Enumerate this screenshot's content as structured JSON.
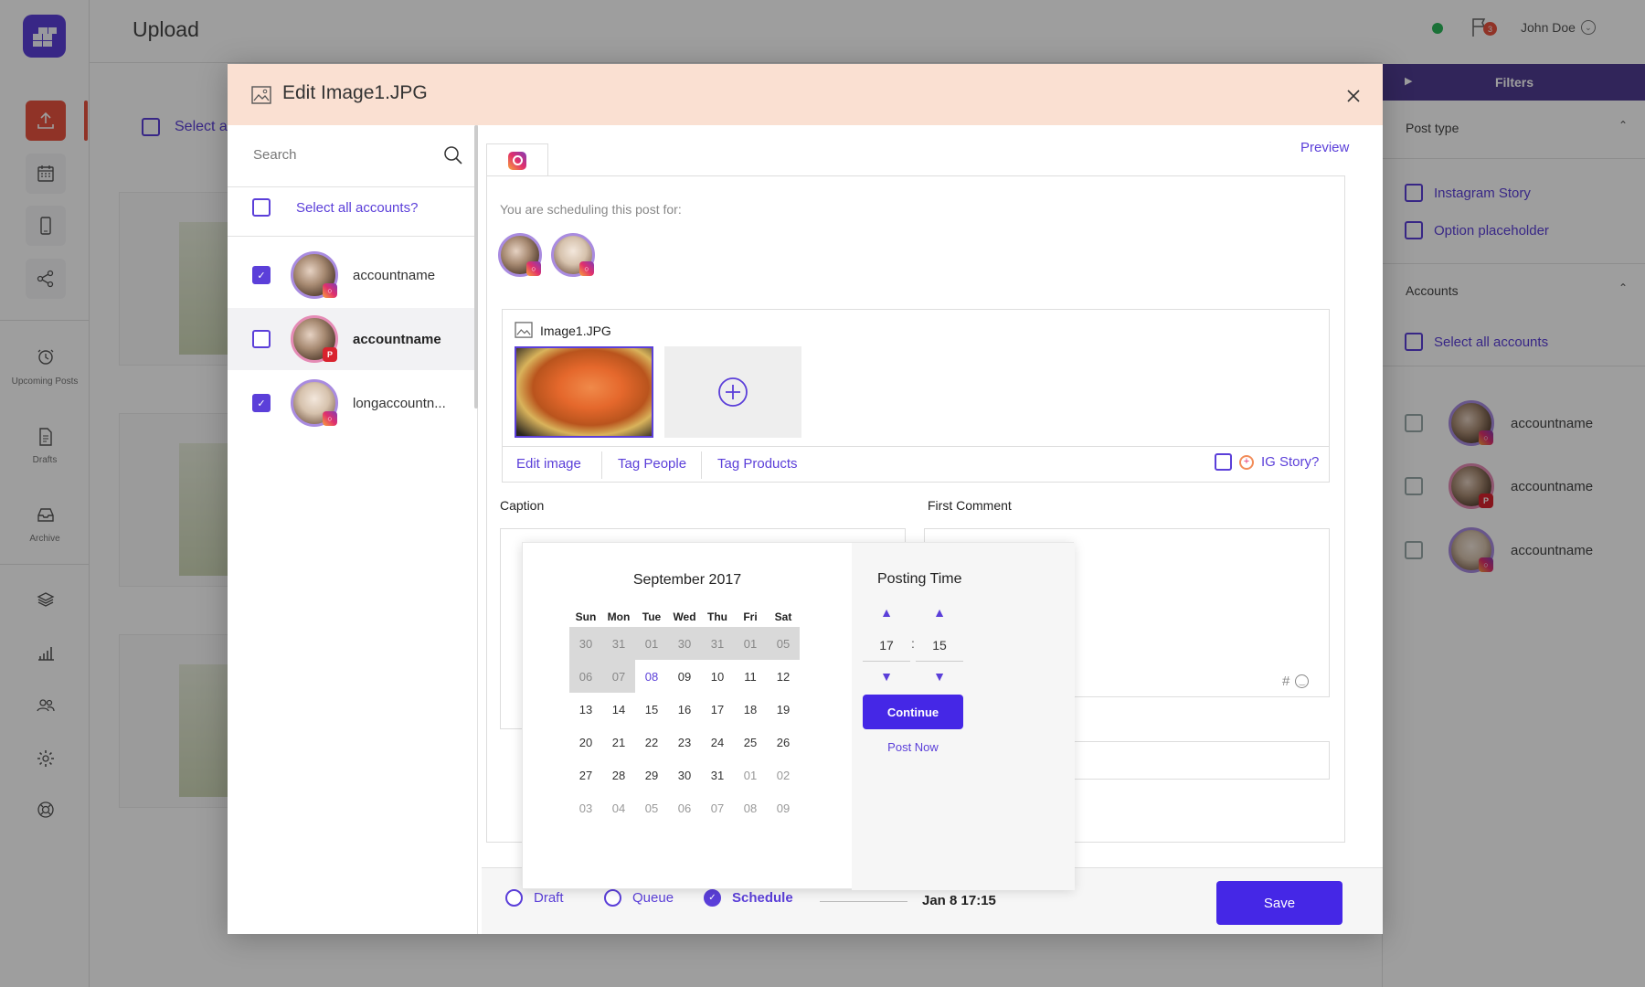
{
  "header": {
    "page_title": "Upload",
    "notifications_count": "3",
    "user_name": "John Doe"
  },
  "nav": {
    "upcoming_label": "Upcoming Posts",
    "drafts_label": "Drafts",
    "archive_label": "Archive"
  },
  "background": {
    "select_all_label": "Select a"
  },
  "filters": {
    "title": "Filters",
    "post_type_label": "Post type",
    "post_type_options": [
      "Instagram Story",
      "Option placeholder"
    ],
    "accounts_label": "Accounts",
    "select_all_accounts": "Select all accounts",
    "accounts": [
      {
        "name": "accountname",
        "network": "instagram"
      },
      {
        "name": "accountname",
        "network": "pinterest"
      },
      {
        "name": "accountname",
        "network": "instagram"
      }
    ]
  },
  "modal": {
    "title": "Edit Image1.JPG",
    "search_placeholder": "Search",
    "select_all_accounts": "Select all accounts?",
    "accounts": [
      {
        "name": "accountname",
        "network": "instagram",
        "checked": true
      },
      {
        "name": "accountname",
        "network": "pinterest",
        "checked": false
      },
      {
        "name": "longaccountn...",
        "network": "instagram",
        "checked": true
      }
    ],
    "preview_label": "Preview",
    "scheduling_text": "You are scheduling this post for:",
    "image_name": "Image1.JPG",
    "image_actions": [
      "Edit image",
      "Tag People",
      "Tag Products"
    ],
    "ig_story_label": "IG Story?",
    "caption_label": "Caption",
    "first_comment_label": "First Comment",
    "comment_icons": "#"
  },
  "calendar": {
    "month_title": "September 2017",
    "weekdays": [
      "Sun",
      "Mon",
      "Tue",
      "Wed",
      "Thu",
      "Fri",
      "Sat"
    ],
    "weeks": [
      [
        "30",
        "31",
        "01",
        "30",
        "31",
        "01",
        "05"
      ],
      [
        "06",
        "07",
        "08",
        "09",
        "10",
        "11",
        "12"
      ],
      [
        "13",
        "14",
        "15",
        "16",
        "17",
        "18",
        "19"
      ],
      [
        "20",
        "21",
        "22",
        "23",
        "24",
        "25",
        "26"
      ],
      [
        "27",
        "28",
        "29",
        "30",
        "31",
        "01",
        "02"
      ],
      [
        "03",
        "04",
        "05",
        "06",
        "07",
        "08",
        "09"
      ]
    ],
    "posting_time_label": "Posting Time",
    "hour": "17",
    "minute": "15",
    "separator": ":",
    "continue_label": "Continue",
    "post_now_label": "Post Now"
  },
  "footer": {
    "options": [
      "Draft",
      "Queue",
      "Schedule"
    ],
    "selected": "Schedule",
    "scheduled_date": "Jan 8 17:15",
    "save_label": "Save"
  },
  "colors": {
    "accent": "#5b3fd9",
    "modal_header": "#fae0d2",
    "upload_active": "#e8533f",
    "filters_header": "#4f3d91"
  }
}
